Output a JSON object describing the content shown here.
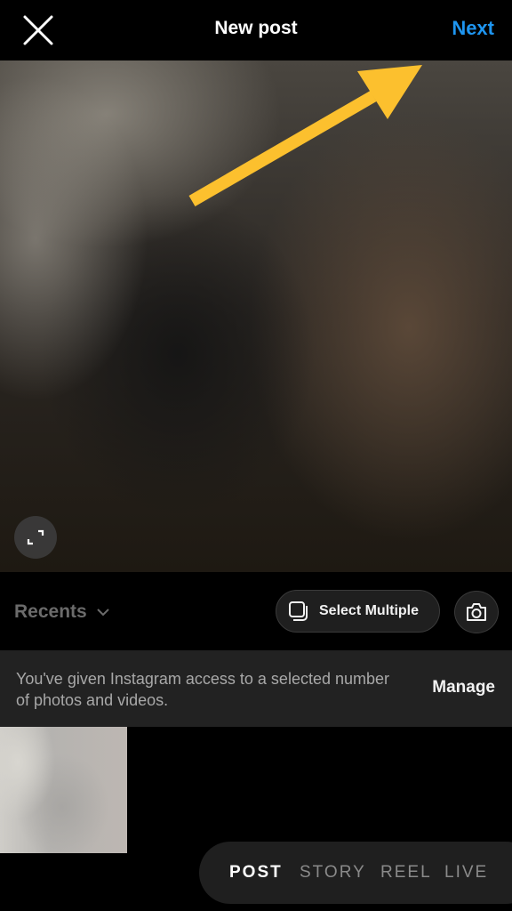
{
  "header": {
    "title": "New post",
    "next_label": "Next",
    "close_icon": "close-icon"
  },
  "preview": {
    "expand_icon": "expand-icon",
    "annotation": "yellow-arrow-pointing-to-next"
  },
  "gallery": {
    "album_label": "Recents",
    "select_multiple_label": "Select Multiple",
    "camera_icon": "camera-icon"
  },
  "banner": {
    "message": "You've given Instagram access to a selected number of photos and videos.",
    "manage_label": "Manage"
  },
  "modes": [
    {
      "label": "POST",
      "active": true
    },
    {
      "label": "STORY",
      "active": false
    },
    {
      "label": "REEL",
      "active": false
    },
    {
      "label": "LIVE",
      "active": false
    }
  ],
  "colors": {
    "accent": "#1e95f0",
    "annotation_arrow": "#fcc02e"
  }
}
